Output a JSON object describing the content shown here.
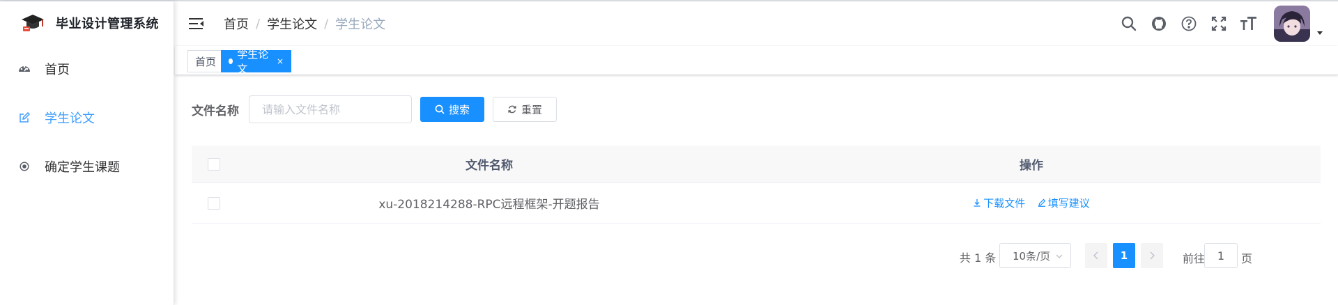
{
  "app": {
    "title": "毕业设计管理系统"
  },
  "sidebar": {
    "items": [
      {
        "label": "首页",
        "icon": "dashboard-icon",
        "active": false
      },
      {
        "label": "学生论文",
        "icon": "edit-icon",
        "active": true
      },
      {
        "label": "确定学生课题",
        "icon": "radio-icon",
        "active": false
      }
    ]
  },
  "header": {
    "breadcrumb": [
      "首页",
      "学生论文",
      "学生论文"
    ],
    "separator": "/",
    "icons": [
      "search-icon",
      "github-icon",
      "help-icon",
      "fullscreen-icon",
      "font-size-icon"
    ]
  },
  "tags": [
    {
      "label": "首页",
      "active": false
    },
    {
      "label": "学生论文",
      "active": true,
      "close": "×"
    }
  ],
  "search": {
    "label": "文件名称",
    "placeholder": "请输入文件名称",
    "search_button": "搜索",
    "reset_button": "重置"
  },
  "table": {
    "columns": [
      "文件名称",
      "操作"
    ],
    "rows": [
      {
        "name": "xu-2018214288-RPC远程框架-开题报告",
        "ops": [
          "下载文件",
          "填写建议"
        ]
      }
    ]
  },
  "pagination": {
    "total_text": "共 1 条",
    "page_size": "10条/页",
    "current_page": "1",
    "jump_prefix": "前往",
    "jump_value": "1",
    "jump_suffix": "页"
  },
  "colors": {
    "primary": "#1890ff",
    "active_menu": "#409eff"
  }
}
